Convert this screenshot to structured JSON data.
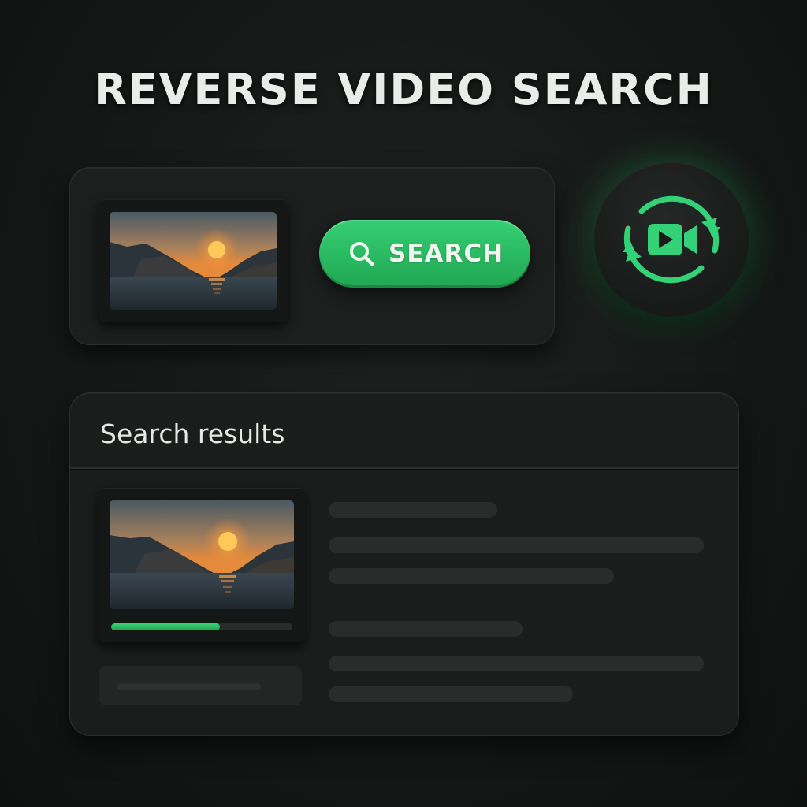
{
  "page": {
    "title": "REVERSE VIDEO SEARCH"
  },
  "query": {
    "search_button_label": "SEARCH",
    "search_icon": "search-icon",
    "reverse_video_icon": "reverse-video-search-icon"
  },
  "results": {
    "heading": "Search results",
    "first_result_progress": 0.6
  },
  "colors": {
    "accent": "#2bbf63",
    "background": "#161818",
    "panel": "#1d1f1f",
    "placeholder": "#2a2c2c"
  }
}
